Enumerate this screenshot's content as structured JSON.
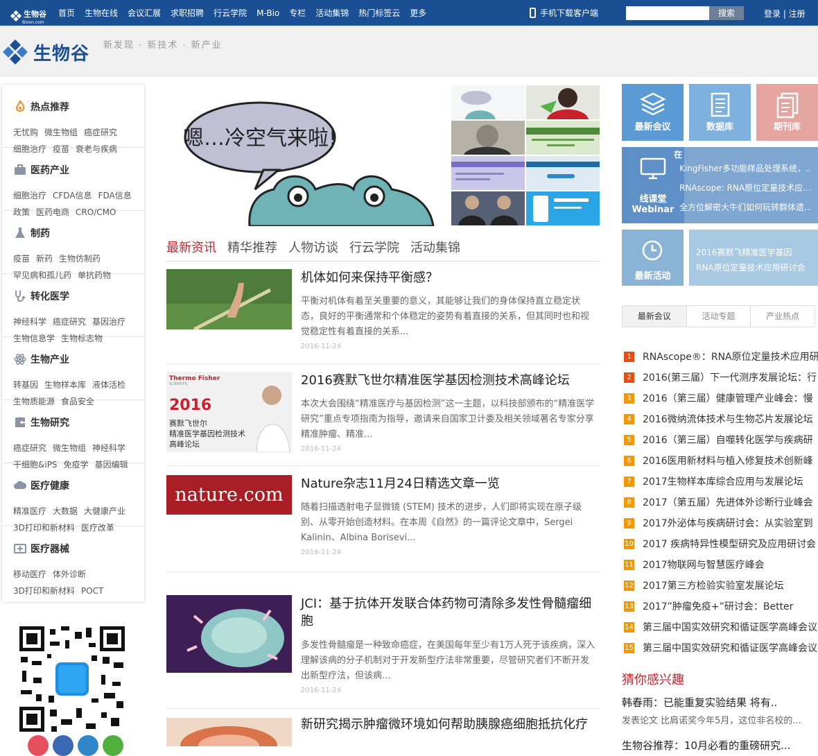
{
  "topbar": {
    "logo_text": "生物谷",
    "logo_sub": "Bioon.com",
    "nav": [
      "首页",
      "生物在线",
      "会议汇展",
      "求职招聘",
      "行云学院",
      "M-Bio",
      "专栏",
      "活动集锦",
      "热门标签云",
      "更多"
    ],
    "mobile": "手机下载客户端",
    "search_placeholder": "",
    "search_btn": "搜索",
    "login": "登录 | 注册"
  },
  "brand": {
    "name": "生物谷",
    "slogan": "新发现 · 新技术 · 新产业"
  },
  "sidebar": [
    {
      "title": "热点推荐",
      "icon": "flame-icon",
      "row1": [
        "无忧购",
        "微生物组",
        "癌症研究"
      ],
      "row2": [
        "细胞治疗",
        "疫苗",
        "衰老与疾病"
      ]
    },
    {
      "title": "医药产业",
      "icon": "briefcase-icon",
      "row1": [
        "细胞治疗",
        "CFDA信息",
        "FDA信息"
      ],
      "row2": [
        "政策",
        "医药电商",
        "CRO/CMO"
      ]
    },
    {
      "title": "制药",
      "icon": "flask-icon",
      "row1": [
        "疫苗",
        "新药",
        "生物仿制药"
      ],
      "row2": [
        "罕见病和孤儿药",
        "单抗药物"
      ]
    },
    {
      "title": "转化医学",
      "icon": "stethoscope-icon",
      "row1": [
        "神经科学",
        "癌症研究",
        "基因治疗"
      ],
      "row2": [
        "生物信息学",
        "生物标志物"
      ]
    },
    {
      "title": "生物产业",
      "icon": "atom-icon",
      "row1": [
        "转基因",
        "生物样本库",
        "液体活检"
      ],
      "row2": [
        "生物质能源",
        "食品安全"
      ]
    },
    {
      "title": "生物研究",
      "icon": "puzzle-icon",
      "row1": [
        "癌症研究",
        "微生物组",
        "神经科学"
      ],
      "row2": [
        "干细胞&iPS",
        "免疫学",
        "基因编辑"
      ]
    },
    {
      "title": "医疗健康",
      "icon": "cloud-icon",
      "row1": [
        "精准医疗",
        "大数据",
        "大健康产业"
      ],
      "row2": [
        "3D打印和新材料",
        "医疗改革"
      ]
    },
    {
      "title": "医疗器械",
      "icon": "device-icon",
      "row1": [
        "移动医疗",
        "体外诊断"
      ],
      "row2": [
        "3D打印和新材料",
        "POCT"
      ]
    }
  ],
  "banner": {
    "speech": "嗯…冷空气来啦!"
  },
  "news_tabs": [
    "最新资讯",
    "精华推荐",
    "人物访谈",
    "行云学院",
    "活动集锦"
  ],
  "articles": [
    {
      "title": "机体如何来保持平衡感？",
      "desc": "平衡对机体有着至关重要的意义，其能够让我们的身体保持直立稳定状态，良好的平衡通常和个体稳定的姿势有着直接的关系，但其同时也和视觉稳定性有着直接的关系...",
      "date": "2016-11-24"
    },
    {
      "title": "2016赛默飞世尔精准医学基因检测技术高峰论坛",
      "desc": "本次大会围绕“精准医疗与基因检测”这一主题，以科技部颁布的“精准医学研究”重点专项指南为指导，邀请来自国家卫计委及相关领域著名专家分享精准肿瘤、精准...",
      "date": "2016-11-24",
      "img": {
        "brand": "Thermo Fisher",
        "brand2": "SCIENTIFIC",
        "year": "2016",
        "l1": "赛默飞世尔",
        "l2": "精准医学基因检测技术",
        "l3": "高峰论坛"
      }
    },
    {
      "title": "Nature杂志11月24日精选文章一览",
      "desc": "随着扫描透射电子显微镜 (STEM) 技术的进步，人们即将实现在原子级别、从零开始创造材料。在本周《自然》的一篇评论文章中，Sergei Kalinin、Albina Borisevi...",
      "date": "2016-11-24",
      "img": {
        "brand": "nature.com"
      }
    },
    {
      "title": "JCI：基于抗体开发联合体药物可清除多发性骨髓瘤细胞",
      "desc": "多发性骨髓瘤是一种致命癌症，在美国每年至少有1万人死于该疾病，深入理解该病的分子机制对于开发新型疗法非常重要，尽管研究者们不断开发出新型疗法，但该病...",
      "date": "2016-11-24"
    },
    {
      "title": "新研究揭示肿瘤微环境如何帮助胰腺癌细胞抵抗化疗",
      "desc": "",
      "date": ""
    }
  ],
  "tiles": [
    {
      "label": "最新会议",
      "icon": "layers-icon",
      "color": "#5b9bd5"
    },
    {
      "label": "数据库",
      "icon": "document-icon",
      "color": "#7fb1de"
    },
    {
      "label": "期刊库",
      "icon": "journal-icon",
      "color": "#e4a5a0"
    }
  ],
  "webinar": {
    "label1": "线课堂",
    "label2": "Webinar",
    "head": "在",
    "items": [
      "KingFisher多功能样品处理系统，...",
      "RNAscope: RNA原位定量技术应...",
      "全方位解密大牛们如何玩转群体遗..."
    ]
  },
  "activity": {
    "label": "最新活动",
    "items": [
      "2016赛默飞精准医学基因",
      "RNA原位定量技术应用研讨会"
    ]
  },
  "meeting_tabs": [
    "最新会议",
    "活动专题",
    "产业热点"
  ],
  "rankings": [
    "RNAscope®：RNA原位定量技术应用研",
    "2016(第三届）下一代测序发展论坛：行",
    "2016（第三届）健康管理产业峰会：慢",
    "2016微纳流体技术与生物芯片发展论坛",
    "2016（第三届）自噬转化医学与疾病研",
    "2016医用新材料与植入修复技术创新峰",
    "2017生物样本库综合应用与发展论坛",
    "2017（第五届）先进体外诊断行业峰会",
    "2017外泌体与疾病研讨会：从实验室到",
    "2017 疾病特异性模型研究及应用研讨会",
    "2017物联网与智慧医疗峰会",
    "2017第三方检验实验室发展论坛",
    "2017”肿瘤免疫+”研讨会：Better",
    "第三届中国实效研究和循证医学高峰会议",
    "第三届中国实效研究和循证医学高峰会议"
  ],
  "guess": {
    "title": "猜你感兴趣",
    "item1": "韩春雨：已能重复实验结果 将有..",
    "desc1": "发表论文 比肩诺奖今年5月，这位非名校的...",
    "item2": "生物谷推荐：10月必看的重磅研究..."
  }
}
